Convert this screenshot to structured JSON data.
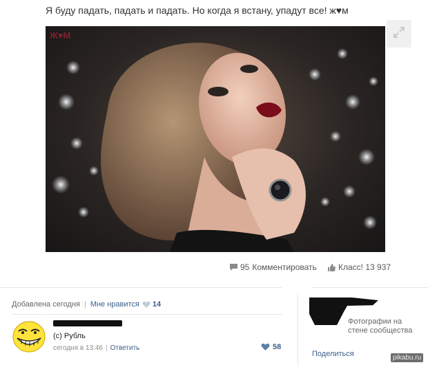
{
  "post": {
    "text": "Я буду падать, падать и падать. Но когда я встану, упадут все! ж♥м",
    "photo_watermark": "Ж♥М",
    "expand_icon": "expand-arrows-icon",
    "comments_count": "95",
    "comments_label": "Комментировать",
    "klass_label": "Класс! 13 937"
  },
  "meta": {
    "added": "Добавлена сегодня",
    "like_label": "Мне нравится",
    "like_count": "14"
  },
  "comment": {
    "text": "(с) Рубль",
    "time": "сегодня в 13:46",
    "reply": "Ответить",
    "likes": "58"
  },
  "sidebar": {
    "caption": "Фотографии на стене сообщества",
    "share": "Поделиться"
  },
  "watermark": "pikabu.ru",
  "colors": {
    "link": "#3a5f8a",
    "text": "#333333",
    "muted": "#666666"
  }
}
